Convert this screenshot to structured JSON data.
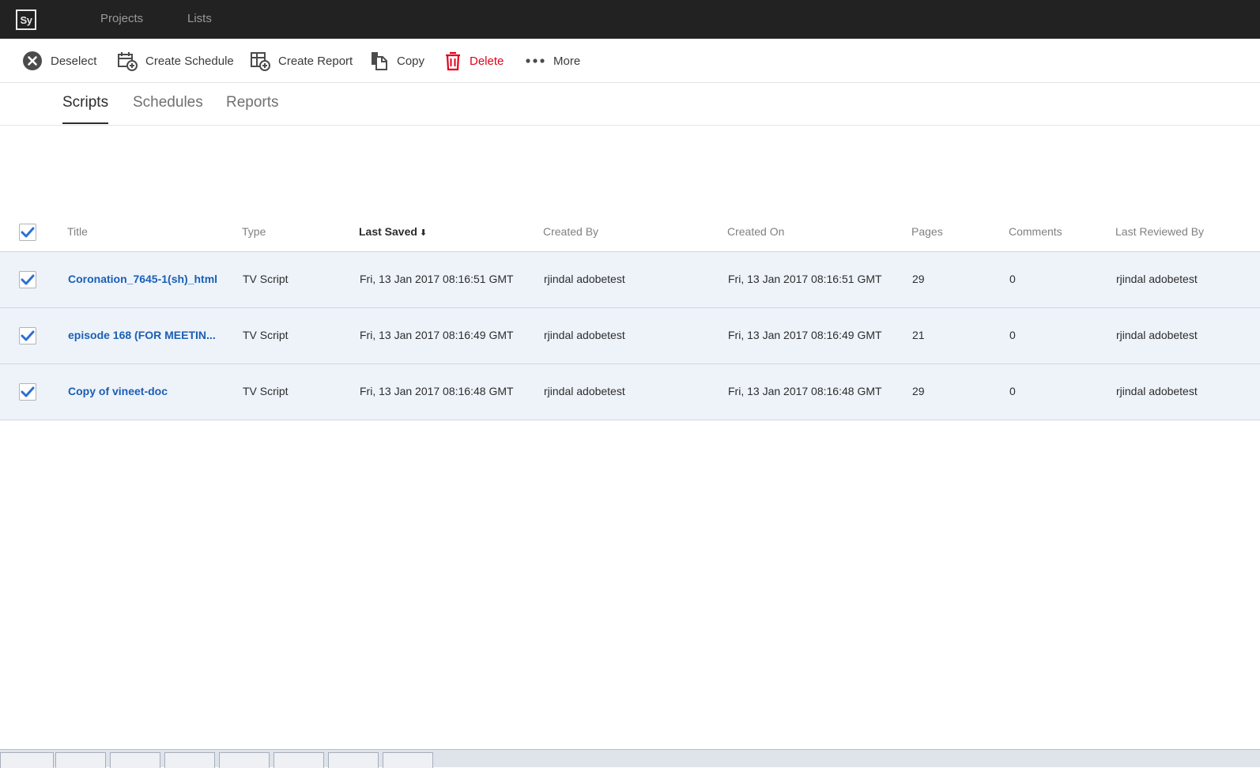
{
  "app": {
    "logo_text": "Sy",
    "nav": [
      "Projects",
      "Lists"
    ]
  },
  "toolbar": {
    "deselect": "Deselect",
    "create_schedule": "Create Schedule",
    "create_report": "Create Report",
    "copy": "Copy",
    "delete": "Delete",
    "more": "More",
    "delete_color": "#e2001a"
  },
  "tabs": {
    "scripts": "Scripts",
    "schedules": "Schedules",
    "reports": "Reports",
    "active": "Scripts"
  },
  "table": {
    "columns": {
      "title": "Title",
      "type": "Type",
      "last_saved": "Last Saved",
      "created_by": "Created By",
      "created_on": "Created On",
      "pages": "Pages",
      "comments": "Comments",
      "last_reviewed_by": "Last Reviewed By"
    },
    "sort_column": "Last Saved",
    "sort_direction": "descending",
    "all_selected": true,
    "rows": [
      {
        "selected": true,
        "title": "Coronation_7645-1(sh)_html",
        "type": "TV Script",
        "last_saved": "Fri, 13 Jan 2017 08:16:51 GMT",
        "created_by": "rjindal adobetest",
        "created_on": "Fri, 13 Jan 2017 08:16:51 GMT",
        "pages": "29",
        "comments": "0",
        "last_reviewed_by": "rjindal adobetest"
      },
      {
        "selected": true,
        "title": "episode 168 (FOR MEETIN...",
        "type": "TV Script",
        "last_saved": "Fri, 13 Jan 2017 08:16:49 GMT",
        "created_by": "rjindal adobetest",
        "created_on": "Fri, 13 Jan 2017 08:16:49 GMT",
        "pages": "21",
        "comments": "0",
        "last_reviewed_by": "rjindal adobetest"
      },
      {
        "selected": true,
        "title": "Copy of vineet-doc",
        "type": "TV Script",
        "last_saved": "Fri, 13 Jan 2017 08:16:48 GMT",
        "created_by": "rjindal adobetest",
        "created_on": "Fri, 13 Jan 2017 08:16:48 GMT",
        "pages": "29",
        "comments": "0",
        "last_reviewed_by": "rjindal adobetest"
      }
    ]
  },
  "colors": {
    "topbar": "#222222",
    "link": "#1a5fb4",
    "checkbox": "#2d6fd3",
    "selected_row": "#eef3fa"
  }
}
